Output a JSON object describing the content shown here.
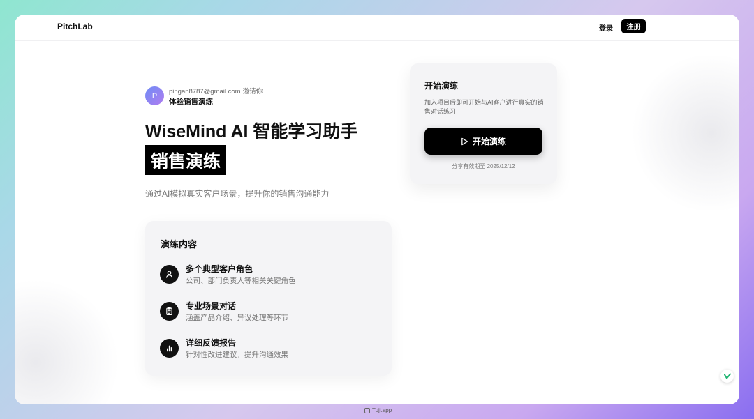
{
  "nav": {
    "brand": "PitchLab",
    "login": "登录",
    "register": "注册"
  },
  "invite": {
    "avatar_letter": "P",
    "email": "pingan8787@gmail.com",
    "invite_text": "邀请你",
    "subtitle": "体验销售演练"
  },
  "hero": {
    "headline": "WiseMind AI 智能学习助手",
    "highlight": "销售演练",
    "subtitle": "通过AI模拟真实客户场景，提升你的销售沟通能力"
  },
  "content_card": {
    "title": "演练内容",
    "features": [
      {
        "icon": "user-icon",
        "title": "多个典型客户角色",
        "desc": "公司、部门负责人等相关关键角色"
      },
      {
        "icon": "clipboard-icon",
        "title": "专业场景对话",
        "desc": "涵盖产品介绍、异议处理等环节"
      },
      {
        "icon": "bar-chart-icon",
        "title": "详细反馈报告",
        "desc": "针对性改进建议，提升沟通效果"
      }
    ]
  },
  "start_card": {
    "title": "开始演练",
    "desc": "加入项目后即可开始与AI客户进行真实的销售对话练习",
    "button": "开始演练",
    "expiry": "分享有效期至 2025/12/12"
  },
  "footer": {
    "watermark": "Tuji.app"
  },
  "colors": {
    "primary": "#000000",
    "card_bg": "#f4f4f6",
    "accent_green": "#22b573"
  }
}
